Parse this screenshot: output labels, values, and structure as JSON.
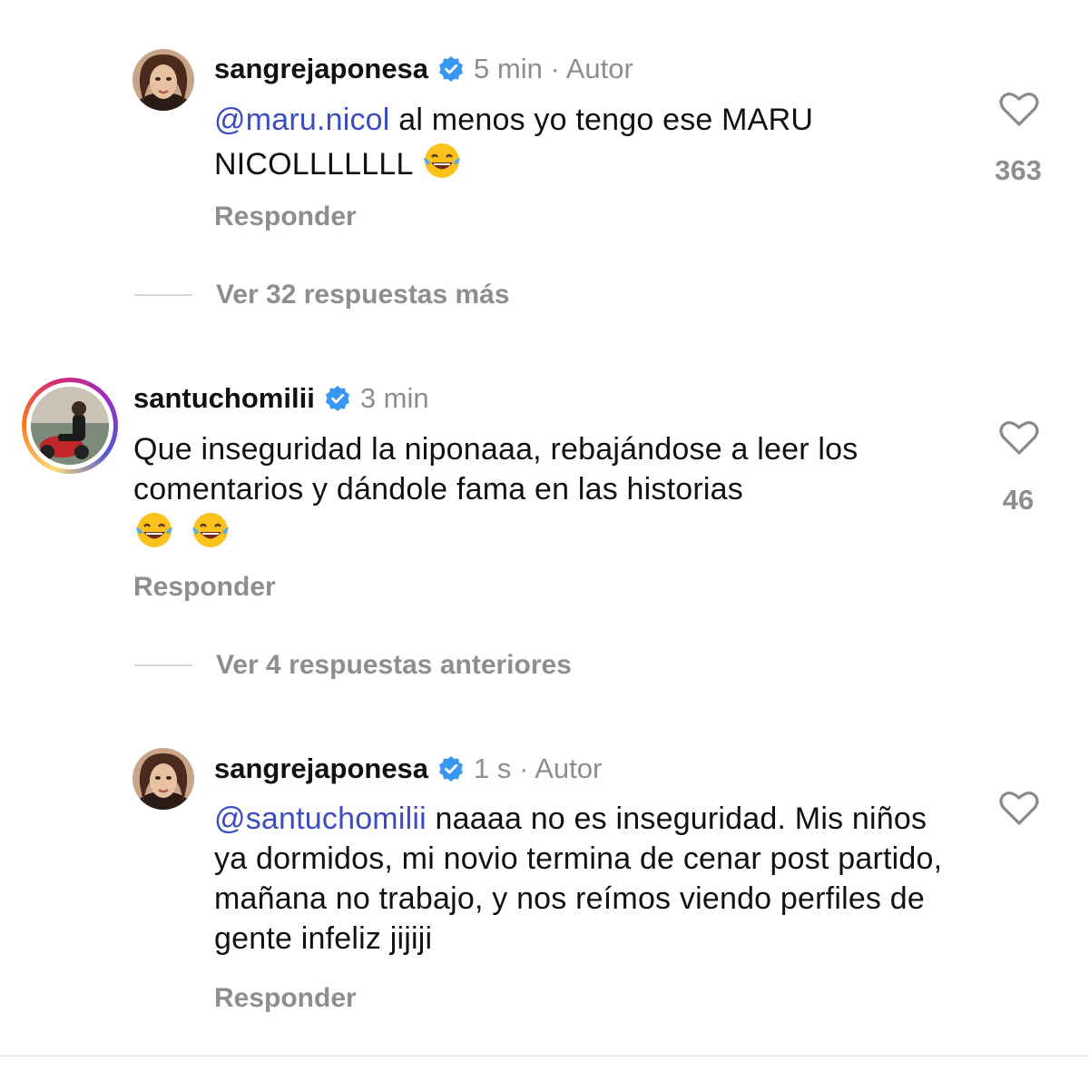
{
  "colors": {
    "mention": "#3b4cc4",
    "muted": "#8e8e8e",
    "verified": "#3897f0"
  },
  "comments": [
    {
      "username": "sangrejaponesa",
      "verified": true,
      "time": "5 min · Autor",
      "mention": "@maru.nicol",
      "text": " al menos yo tengo ese MARU NICOLLLLLLL ",
      "emoji": "face-with-tears-of-joy",
      "reply_label": "Responder",
      "likes": "363"
    },
    {
      "username": "santuchomilii",
      "verified": true,
      "time": "3 min",
      "text": "Que inseguridad la niponaaa, rebajándose a leer los comentarios y dándole fama en las historias",
      "emoji": "face-with-tears-of-joy x2",
      "reply_label": "Responder",
      "likes": "46"
    },
    {
      "username": "sangrejaponesa",
      "verified": true,
      "time": "1 s · Autor",
      "mention": "@santuchomilii",
      "text": " naaaa no es inseguridad. Mis niños ya dormidos, mi novio termina de cenar post partido, mañana no trabajo, y nos reímos viendo perfiles de gente infeliz jijiji",
      "reply_label": "Responder",
      "likes": ""
    }
  ],
  "view_more": [
    {
      "label": "Ver 32 respuestas más"
    },
    {
      "label": "Ver 4 respuestas anteriores"
    }
  ]
}
